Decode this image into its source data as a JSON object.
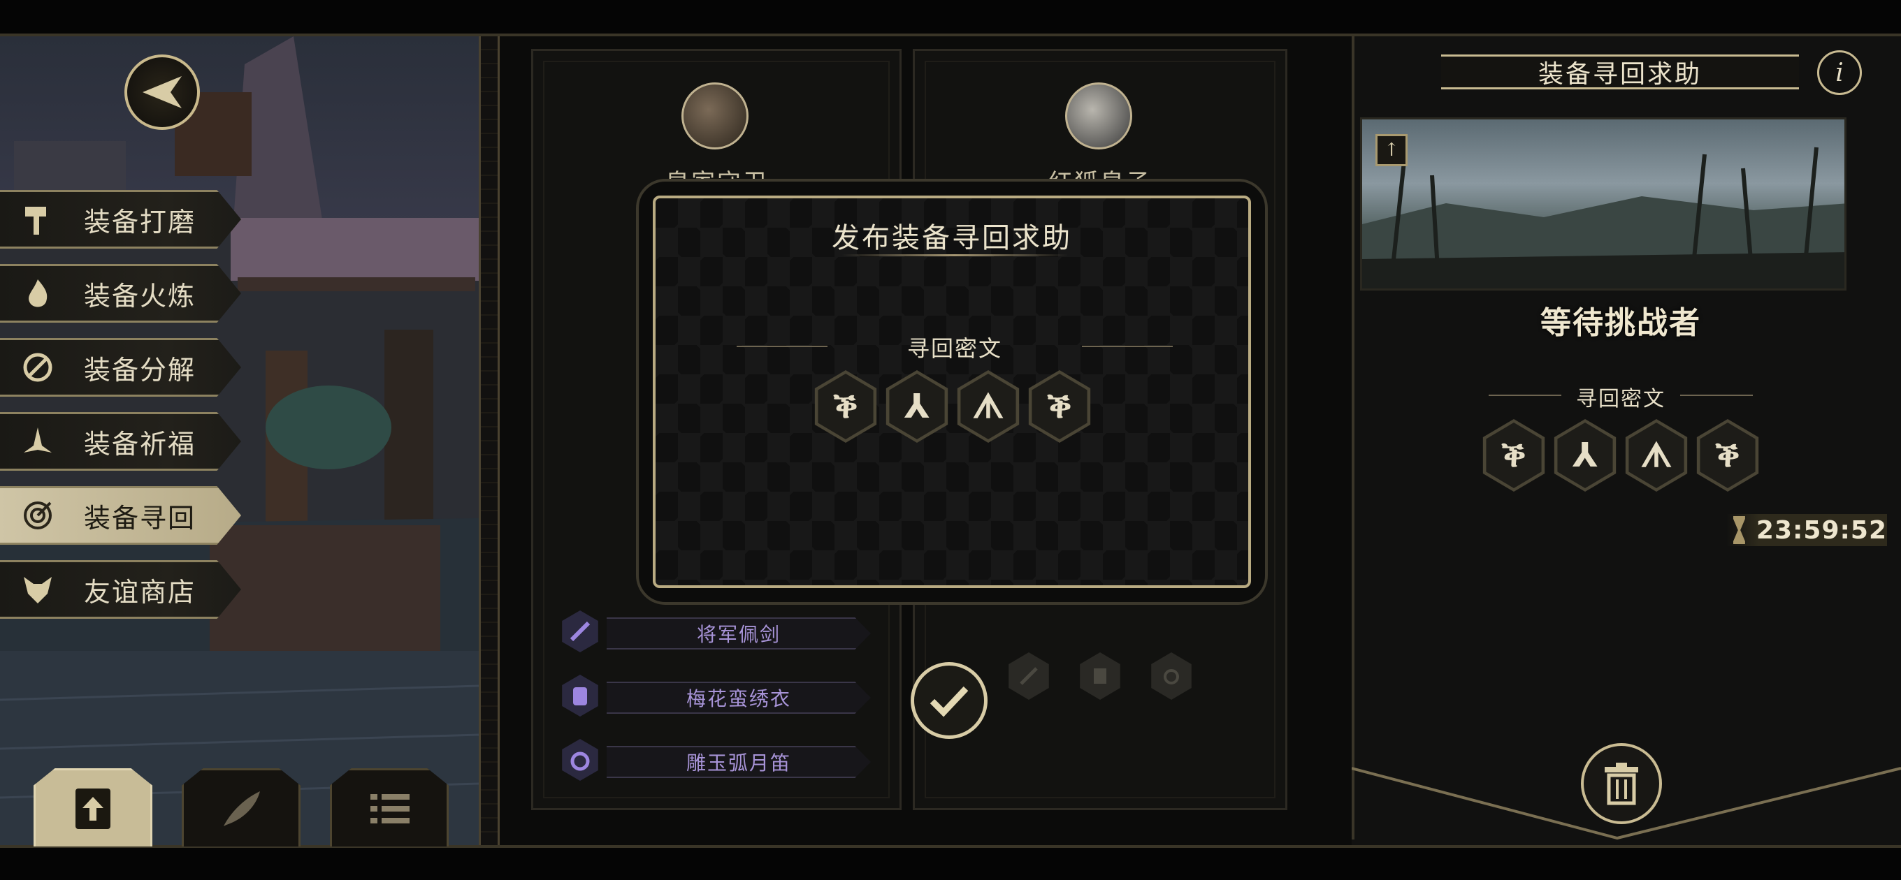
{
  "left_menu": {
    "items": [
      {
        "label": "装备打磨",
        "icon": "hammer-icon"
      },
      {
        "label": "装备火炼",
        "icon": "flame-icon"
      },
      {
        "label": "装备分解",
        "icon": "disassemble-icon"
      },
      {
        "label": "装备祈福",
        "icon": "pray-icon"
      },
      {
        "label": "装备寻回",
        "icon": "target-icon",
        "active": true
      },
      {
        "label": "友谊商店",
        "icon": "fox-icon"
      }
    ]
  },
  "bottom_tabs": [
    {
      "icon": "upload-file-icon",
      "active": true
    },
    {
      "icon": "feather-icon"
    },
    {
      "icon": "list-icon"
    }
  ],
  "cards": {
    "left_name": "皇家守卫",
    "right_name": "红狐皇子"
  },
  "equipment": [
    {
      "name": "将军佩剑",
      "icon": "sword-icon"
    },
    {
      "name": "梅花蛮绣衣",
      "icon": "armor-icon"
    },
    {
      "name": "雕玉弧月笛",
      "icon": "ring-icon"
    }
  ],
  "modal": {
    "title": "发布装备寻回求助",
    "section_label": "寻回密文",
    "runes": [
      "ቕ",
      "⅄",
      "ᗑ",
      "ቕ"
    ]
  },
  "right_panel": {
    "title": "装备寻回求助",
    "info_label": "i",
    "status": "等待挑战者",
    "section_label": "寻回密文",
    "runes": [
      "ቕ",
      "⅄",
      "ᗑ",
      "ቕ"
    ],
    "timer": "23:59:52"
  },
  "colors": {
    "accent_gold": "#c9bb92",
    "equip_purple": "#a894d8",
    "panel_dark": "#111110"
  }
}
